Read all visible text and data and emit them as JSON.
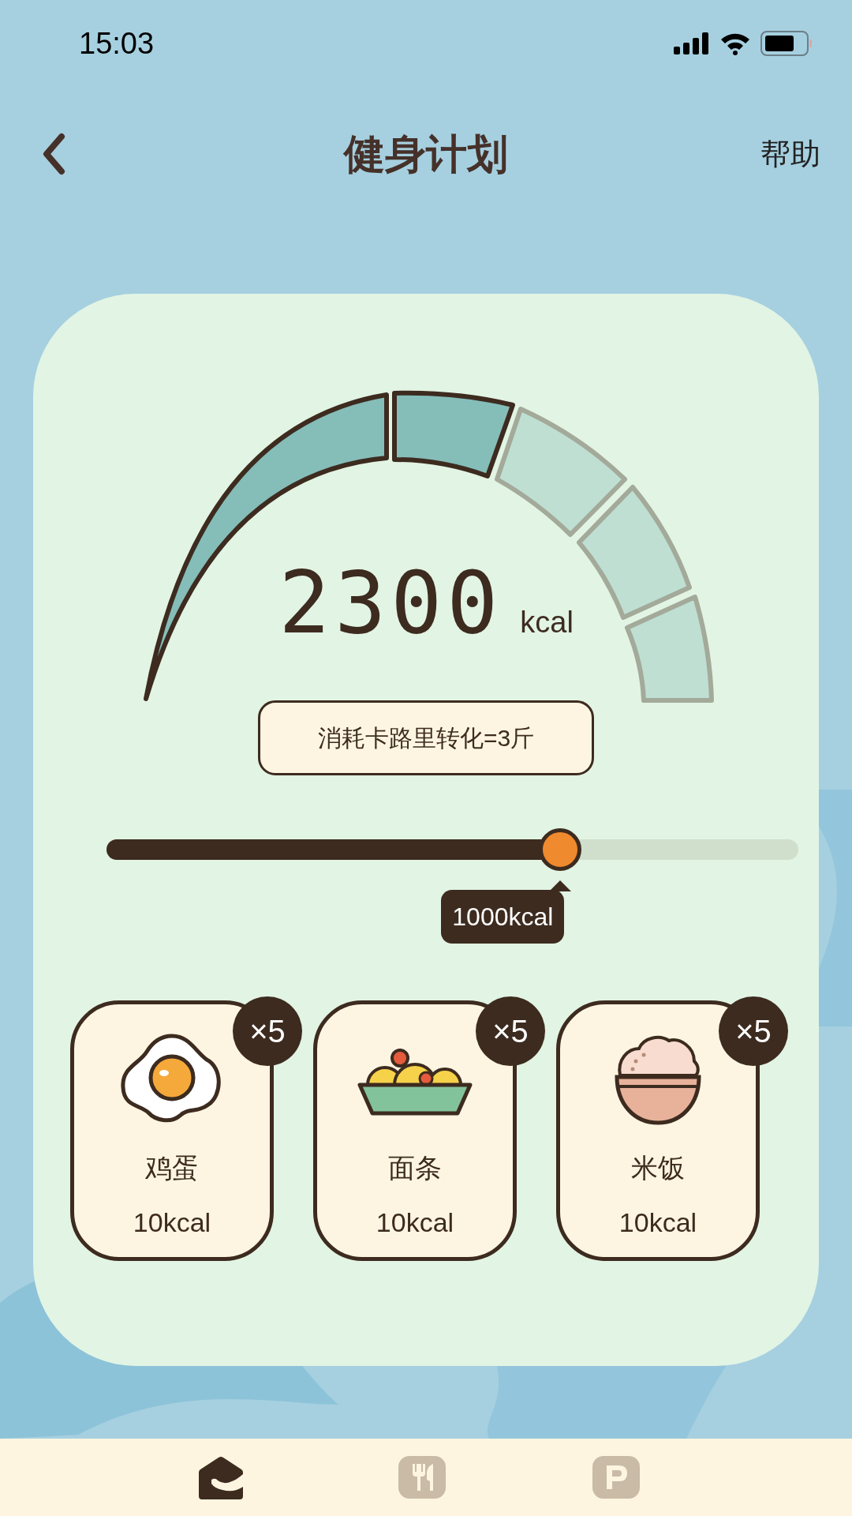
{
  "status_bar": {
    "time": "15:03"
  },
  "header": {
    "title": "健身计划",
    "action": "帮助"
  },
  "gauge": {
    "value": "2300",
    "unit": "kcal",
    "segments": [
      {
        "filled": true
      },
      {
        "filled": true
      },
      {
        "filled": false
      },
      {
        "filled": false
      },
      {
        "filled": false
      }
    ]
  },
  "conversion": "消耗卡路里转化=3斤",
  "slider": {
    "level": 0.656,
    "tooltip": "1000kcal"
  },
  "foods": [
    {
      "kind": "egg",
      "name": "鸡蛋",
      "calories": "10kcal",
      "count": "×5"
    },
    {
      "kind": "noodles",
      "name": "面条",
      "calories": "10kcal",
      "count": "×5"
    },
    {
      "kind": "rice",
      "name": "米饭",
      "calories": "10kcal",
      "count": "×5"
    }
  ],
  "nav": [
    {
      "kind": "home",
      "selected": true
    },
    {
      "kind": "food",
      "selected": false
    },
    {
      "kind": "parking",
      "selected": false
    }
  ]
}
